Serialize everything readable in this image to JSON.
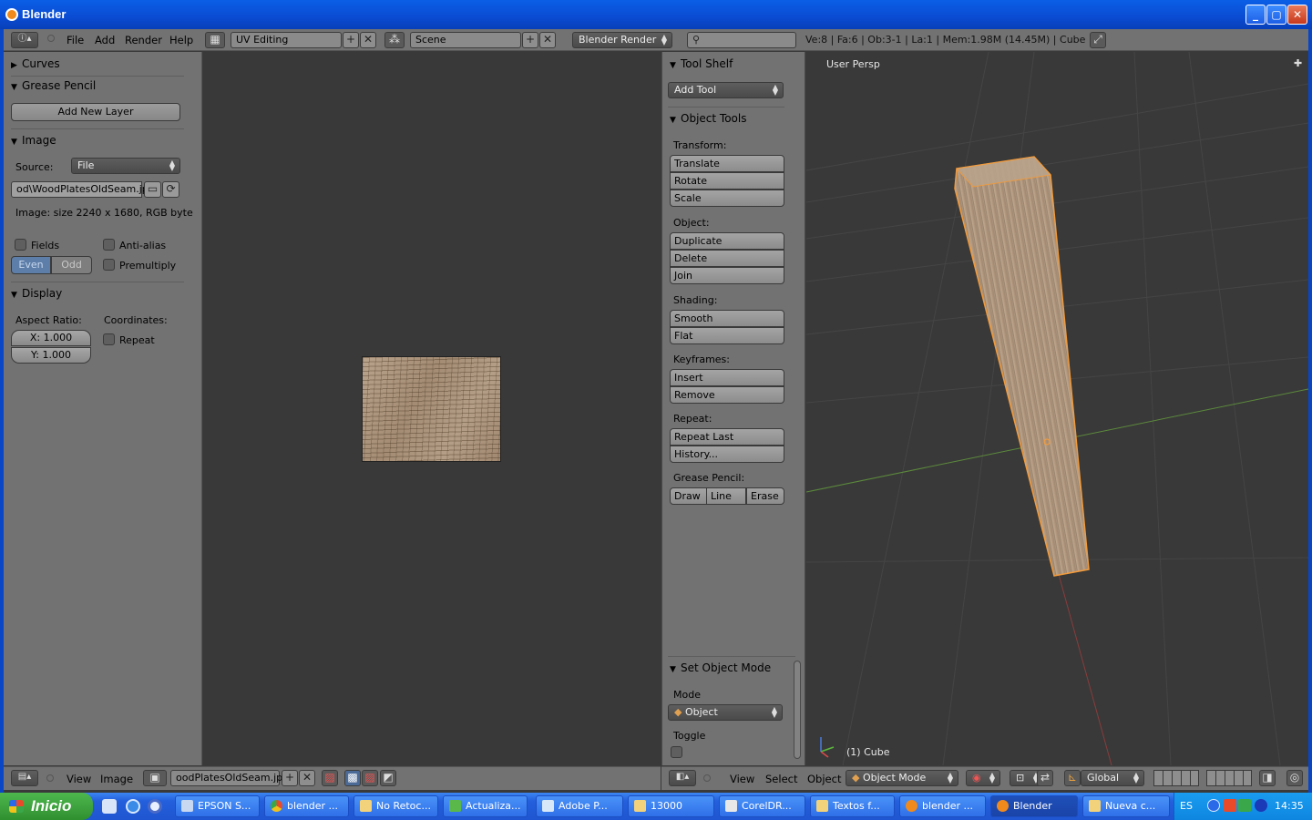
{
  "window": {
    "title": "Blender"
  },
  "header": {
    "menus": [
      "File",
      "Add",
      "Render",
      "Help"
    ],
    "screen_layout": "UV Editing",
    "scene": "Scene",
    "render_engine": "Blender Render",
    "stats": "Ve:8 | Fa:6 | Ob:3-1 | La:1 | Mem:1.98M (14.45M) | Cube"
  },
  "left_panel": {
    "curves": "Curves",
    "grease_pencil": "Grease Pencil",
    "add_new_layer": "Add New Layer",
    "image": "Image",
    "source_label": "Source:",
    "source_value": "File",
    "filepath": "od\\WoodPlatesOldSeam.jpg",
    "image_info": "Image: size 2240 x 1680, RGB byte",
    "fields": "Fields",
    "anti_alias": "Anti-alias",
    "even": "Even",
    "odd": "Odd",
    "premultiply": "Premultiply",
    "display": "Display",
    "aspect_ratio": "Aspect Ratio:",
    "coordinates": "Coordinates:",
    "x_value": "X: 1.000",
    "y_value": "Y: 1.000",
    "repeat": "Repeat"
  },
  "tool_shelf": {
    "title": "Tool Shelf",
    "add_tool": "Add Tool",
    "object_tools": "Object Tools",
    "transform_label": "Transform:",
    "translate": "Translate",
    "rotate": "Rotate",
    "scale": "Scale",
    "object_label": "Object:",
    "duplicate": "Duplicate",
    "delete": "Delete",
    "join": "Join",
    "shading_label": "Shading:",
    "smooth": "Smooth",
    "flat": "Flat",
    "keyframes_label": "Keyframes:",
    "insert": "Insert",
    "remove": "Remove",
    "repeat_label": "Repeat:",
    "repeat_last": "Repeat Last",
    "history": "History...",
    "grease_pencil_label": "Grease Pencil:",
    "draw": "Draw",
    "line": "Line",
    "erase": "Erase",
    "set_object_mode": "Set Object Mode",
    "mode_label": "Mode",
    "mode_value": "Object",
    "toggle_label": "Toggle"
  },
  "view3d": {
    "view_name": "User Persp",
    "object_name": "(1) Cube"
  },
  "bottom_left": {
    "menus": [
      "View",
      "Image"
    ],
    "image_name": "oodPlatesOldSeam.jpg"
  },
  "bottom_right": {
    "menus": [
      "View",
      "Select",
      "Object"
    ],
    "mode": "Object Mode",
    "orientation": "Global"
  },
  "taskbar": {
    "start": "Inicio",
    "tasks": [
      "EPSON S...",
      "blender ...",
      "No Retoc...",
      "Actualiza...",
      "Adobe P...",
      "13000",
      "CorelDR...",
      "Textos f...",
      "blender ...",
      "Blender",
      "Nueva c..."
    ],
    "lang": "ES",
    "clock": "14:35"
  },
  "colors": {
    "accent": "#f08a1c",
    "selection": "#f29b3c",
    "panel": "#727272",
    "viewport": "#393939"
  }
}
